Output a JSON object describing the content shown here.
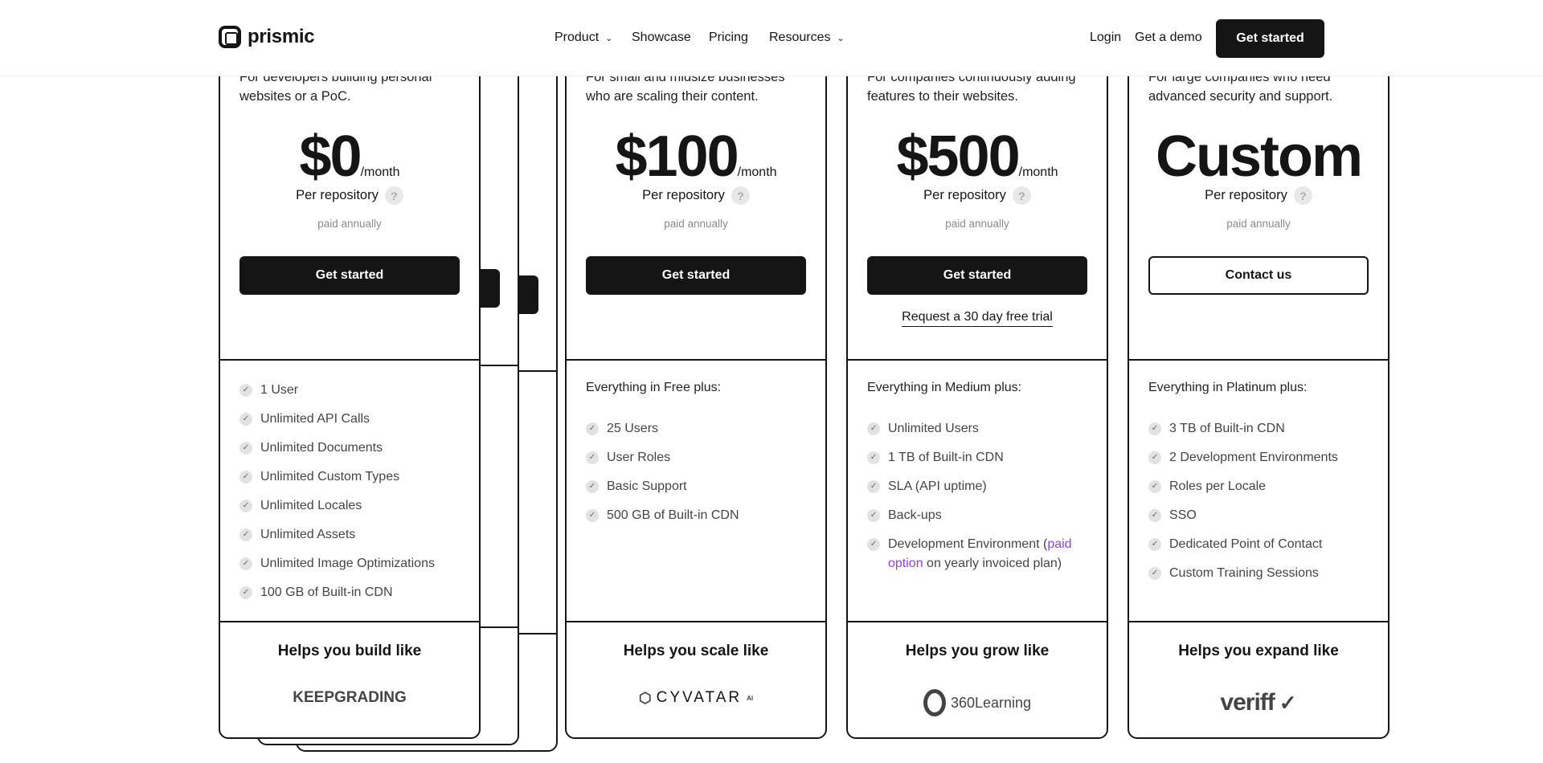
{
  "header": {
    "logo": "prismic",
    "nav": [
      {
        "label": "Product",
        "dropdown": true
      },
      {
        "label": "Showcase"
      },
      {
        "label": "Pricing"
      },
      {
        "label": "Resources",
        "dropdown": true
      }
    ],
    "login": "Login",
    "demo": "Get a demo",
    "get_started": "Get started"
  },
  "plans": [
    {
      "desc": "For developers building personal websites or a PoC.",
      "price": "$0",
      "period": "/month",
      "per": "Per repository",
      "billing": "paid annually",
      "cta": "Get started",
      "features": [
        "1 User",
        "Unlimited API Calls",
        "Unlimited Documents",
        "Unlimited Custom Types",
        "Unlimited Locales",
        "Unlimited Assets",
        "Unlimited Image Optimizations",
        "100 GB of Built-in CDN"
      ],
      "helps": "Helps you build like",
      "brand": "KEEPGRADING"
    },
    {
      "desc": "For small and midsize businesses who are scaling their content.",
      "price": "$100",
      "period": "/month",
      "per": "Per repository",
      "billing": "paid annually",
      "cta": "Get started",
      "intro": "Everything in Free plus:",
      "features": [
        "25 Users",
        "User Roles",
        "Basic Support",
        "500 GB of Built-in CDN"
      ],
      "helps": "Helps you scale like",
      "brand": "CYVATAR",
      "brand_sup": "AI"
    },
    {
      "desc": "For companies continuously adding features to their websites.",
      "price": "$500",
      "period": "/month",
      "per": "Per repository",
      "billing": "paid annually",
      "cta": "Get started",
      "trial": "Request a 30 day free trial",
      "intro": "Everything in Medium plus:",
      "features": [
        "Unlimited Users",
        "1 TB of Built-in CDN",
        "SLA (API uptime)",
        "Back-ups"
      ],
      "feature_last": {
        "pre": "Development Environment (",
        "link": "paid option",
        "post": " on yearly invoiced plan)"
      },
      "helps": "Helps you grow like",
      "brand": "360Learning"
    },
    {
      "desc": "For large companies who need advanced security and support.",
      "price": "Custom",
      "per": "Per repository",
      "billing": "paid annually",
      "cta": "Contact us",
      "intro": "Everything in Platinum plus:",
      "features": [
        "3 TB of Built-in CDN",
        "2 Development Environments",
        "Roles per Locale",
        "SSO",
        "Dedicated Point of Contact",
        "Custom Training Sessions"
      ],
      "helps": "Helps you expand like",
      "brand": "veriff"
    }
  ],
  "colors": {
    "accent": "#151515",
    "link": "#8a3ffc"
  }
}
